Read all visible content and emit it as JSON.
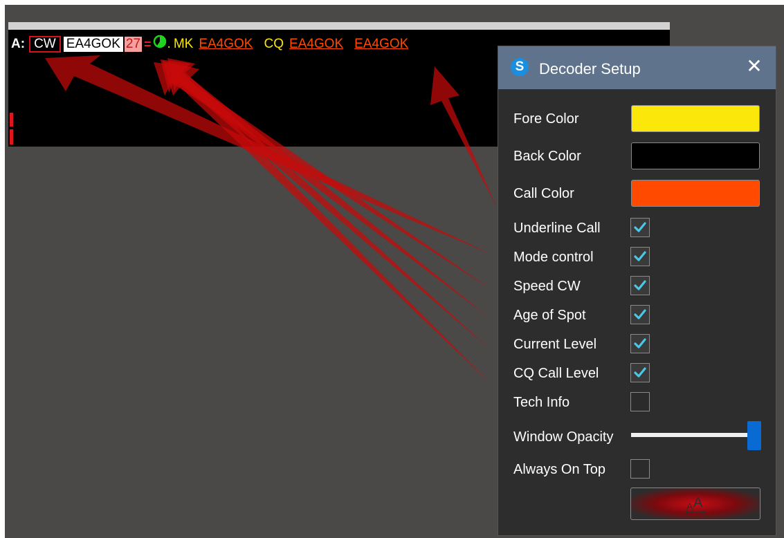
{
  "decoder": {
    "band_label": "A:",
    "mode": "CW",
    "call": "EA4GOK",
    "speed": "27",
    "level_symbol": "=",
    "dot": ".",
    "mk_label": "MK",
    "mk_call": "EA4GOK",
    "cq_label": "CQ",
    "cq_call": "EA4GOK",
    "last_call": "EA4GOK",
    "age_icon": "clock-pie-icon",
    "colors": {
      "fore": "#ffe400",
      "back": "#000000",
      "call": "#ff4a00",
      "mode_border": "#d4141c",
      "speed_bg": "#f4a09e",
      "age_icon": "#1ed41e"
    }
  },
  "dialog": {
    "title": "Decoder Setup",
    "app_icon": "S",
    "close_icon": "close-icon",
    "fore_color_label": "Fore Color",
    "fore_color": "#fce70b",
    "back_color_label": "Back Color",
    "back_color": "#000000",
    "call_color_label": "Call Color",
    "call_color": "#ff4a00",
    "options": [
      {
        "label": "Underline Call",
        "checked": true
      },
      {
        "label": "Mode control",
        "checked": true
      },
      {
        "label": "Speed CW",
        "checked": true
      },
      {
        "label": "Age of Spot",
        "checked": true
      },
      {
        "label": "Current Level",
        "checked": true
      },
      {
        "label": "CQ Call Level",
        "checked": true
      },
      {
        "label": "Tech Info",
        "checked": false
      }
    ],
    "window_opacity_label": "Window Opacity",
    "window_opacity": 1.0,
    "always_on_top_label": "Always On Top",
    "always_on_top": false,
    "font_button_icon": "font-size-icon"
  }
}
